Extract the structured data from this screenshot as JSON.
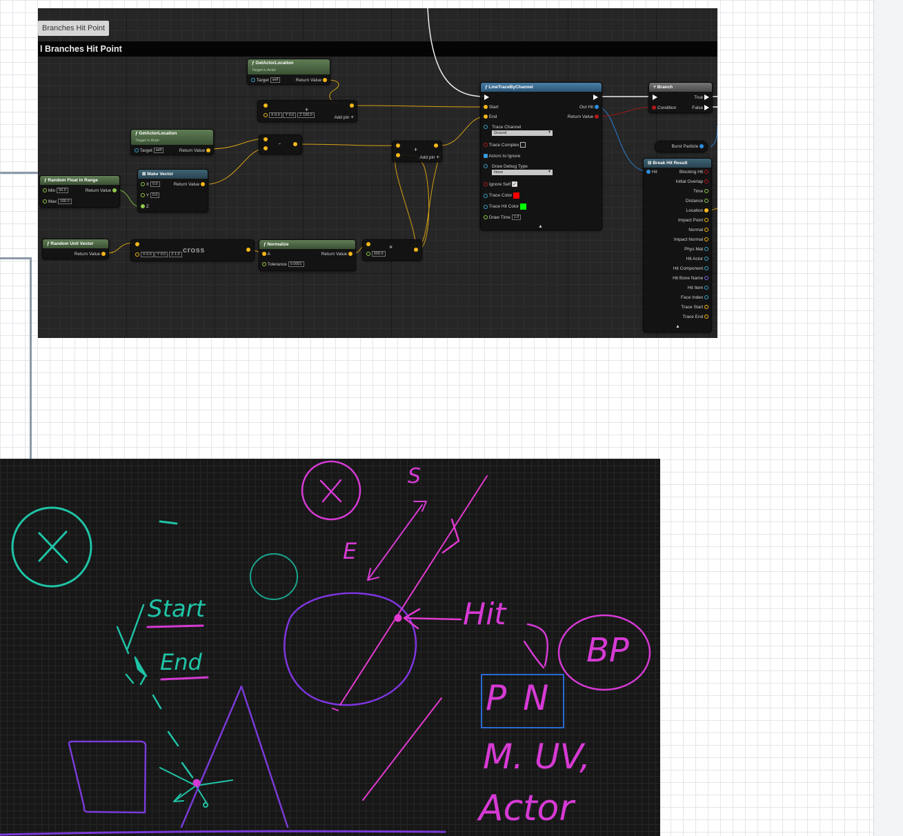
{
  "blueprint": {
    "tab_label": "Branches Hit Point",
    "graph_title": "l Branches Hit Point",
    "nodes": {
      "get_actor_location_1": {
        "title": "GetActorLocation",
        "subtitle": "Target is Actor",
        "target_label": "Target",
        "target_value": "self",
        "return_label": "Return Value"
      },
      "get_actor_location_2": {
        "title": "GetActorLocation",
        "subtitle": "Target is Actor",
        "target_label": "Target",
        "target_value": "self",
        "return_label": "Return Value"
      },
      "add_vector": {
        "x": "0.0",
        "y": "0.0",
        "z": "100.0",
        "add_pin": "Add pin",
        "operator": "+"
      },
      "subtract": {
        "operator": "-"
      },
      "add_result": {
        "operator": "+",
        "add_pin": "Add pin"
      },
      "random_float": {
        "title": "Random Float in Range",
        "min_label": "Min",
        "min_value": "50.0",
        "max_label": "Max",
        "max_value": "100.0",
        "return_label": "Return Value"
      },
      "make_vector": {
        "title": "Make Vector",
        "x_label": "X",
        "x_value": "0.0",
        "y_label": "Y",
        "y_value": "0.0",
        "z_label": "Z",
        "return_label": "Return Value"
      },
      "random_unit_vector": {
        "title": "Random Unit Vector",
        "return_label": "Return Value"
      },
      "cross": {
        "label": "cross",
        "x": "0.0",
        "y": "0.0",
        "z": "1.0"
      },
      "normalize": {
        "title": "Normalize",
        "a_label": "A",
        "tolerance_label": "Tolerance",
        "tolerance_value": "0.0001",
        "return_label": "Return Value"
      },
      "multiply": {
        "value": "500.0",
        "operator": "×"
      },
      "line_trace": {
        "title": "LineTraceByChannel",
        "start": "Start",
        "end": "End",
        "out_hit": "Out Hit",
        "return_value": "Return Value",
        "trace_channel_label": "Trace Channel",
        "trace_channel_value": "Ground",
        "trace_complex": "Trace Complex",
        "actors_to_ignore": "Actors to Ignore",
        "draw_debug_label": "Draw Debug Type",
        "draw_debug_value": "None",
        "ignore_self": "Ignore Self",
        "trace_color": "Trace Color",
        "trace_hit_color": "Trace Hit Color",
        "draw_time_label": "Draw Time",
        "draw_time_value": "1.0"
      },
      "branch": {
        "title": "Branch",
        "condition": "Condition",
        "true_label": "True",
        "false_label": "False"
      },
      "burst_particle": {
        "label": "Burst Particle"
      },
      "break_hit_result": {
        "title": "Break Hit Result",
        "input": "Hit",
        "outputs": [
          "Blocking Hit",
          "Initial Overlap",
          "Time",
          "Distance",
          "Location",
          "Impact Point",
          "Normal",
          "Impact Normal",
          "Phys Mat",
          "Hit Actor",
          "Hit Component",
          "Hit Bone Name",
          "Hit Item",
          "Face Index",
          "Trace Start",
          "Trace End"
        ]
      }
    },
    "colors": {
      "vector_pin": "#f6b81a",
      "float_pin": "#92c94b",
      "struct_pin": "#2e8fe0",
      "bool_pin": "#b21a1a",
      "trace_color": "#ff0000",
      "trace_hit_color": "#00ff00"
    }
  },
  "drawing": {
    "labels": {
      "start": "Start",
      "end": "End",
      "s": "S",
      "e": "E",
      "hit": "Hit",
      "bp": "BP",
      "pn": "P N",
      "muv": "M. UV,",
      "actor": "Actor"
    },
    "colors": {
      "teal": "#1fc4a6",
      "magenta": "#d63ad4",
      "purple": "#7a3ad8",
      "blue": "#2a6ad4",
      "pink_line": "#e23ad0"
    }
  }
}
